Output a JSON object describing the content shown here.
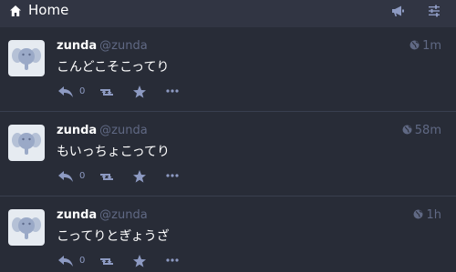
{
  "header": {
    "title": "Home",
    "icons": [
      "home-icon",
      "megaphone-icon",
      "sliders-icon"
    ]
  },
  "statuses": [
    {
      "display_name": "zunda",
      "username": "@zunda",
      "time": "1m",
      "visibility_icon": "globe-icon",
      "content": "こんどこそこってり",
      "reply_count": "0"
    },
    {
      "display_name": "zunda",
      "username": "@zunda",
      "time": "58m",
      "visibility_icon": "globe-icon",
      "content": "もいっちょこってり",
      "reply_count": "0"
    },
    {
      "display_name": "zunda",
      "username": "@zunda",
      "time": "1h",
      "visibility_icon": "globe-icon",
      "content": "こってりとぎょうざ",
      "reply_count": "0"
    }
  ],
  "colors": {
    "background": "#282c37",
    "header": "#313543",
    "muted": "#606984",
    "action": "#8d9ac2"
  }
}
